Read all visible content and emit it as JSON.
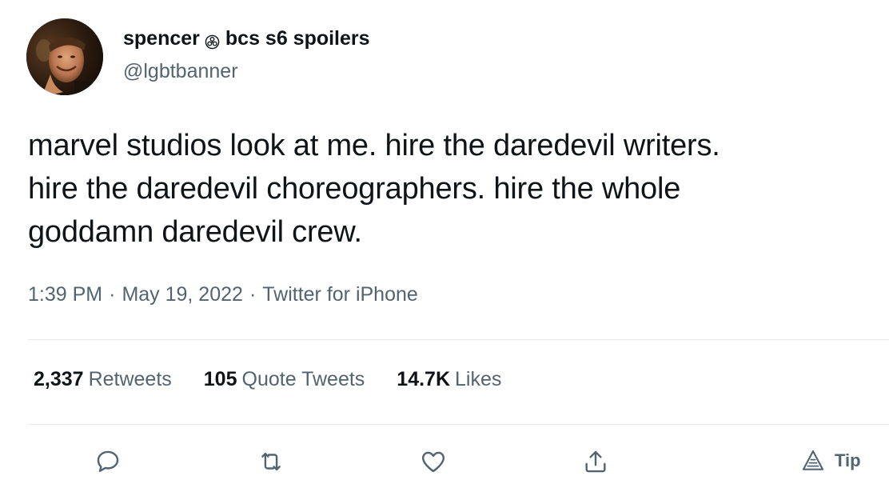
{
  "user": {
    "display_name_part1": "spencer",
    "display_name_part2": "bcs s6 spoilers",
    "name_emoji": "biohazard-icon",
    "handle": "@lgbtbanner",
    "avatar": "avatar-photo"
  },
  "tweet": {
    "lines": [
      "marvel studios look at me. hire the daredevil writers.",
      "hire the daredevil choreographers. hire the whole",
      "goddamn daredevil crew."
    ],
    "time": "1:39 PM",
    "date": "May 19, 2022",
    "source": "Twitter for iPhone",
    "separator": "·"
  },
  "stats": {
    "retweets_count": "2,337",
    "retweets_label": "Retweets",
    "quotes_count": "105",
    "quotes_label": "Quote Tweets",
    "likes_count": "14.7K",
    "likes_label": "Likes"
  },
  "actions": {
    "reply_icon": "reply-icon",
    "retweet_icon": "retweet-icon",
    "like_icon": "heart-icon",
    "share_icon": "share-icon",
    "tip_label": "Tip"
  },
  "colors": {
    "text": "#0f1419",
    "secondary": "#536471",
    "divider": "#e6eaed"
  }
}
